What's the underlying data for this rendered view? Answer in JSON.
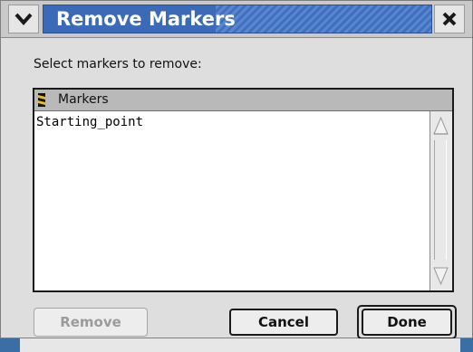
{
  "window": {
    "title": "Remove Markers"
  },
  "dialog": {
    "prompt": "Select markers to remove:"
  },
  "list": {
    "header_label": "Markers",
    "items": [
      "Starting_point"
    ]
  },
  "buttons": {
    "remove": "Remove",
    "cancel": "Cancel",
    "done": "Done"
  },
  "icons": {
    "collapse": "chevron-down-icon",
    "close": "close-icon",
    "marker": "marker-flag-icon",
    "scroll_up": "scroll-up-arrow-icon",
    "scroll_down": "scroll-down-arrow-icon"
  },
  "colors": {
    "title_bar": "#3b6bb8",
    "desktop": "#3a6ea5",
    "dialog_bg": "#dedede"
  }
}
